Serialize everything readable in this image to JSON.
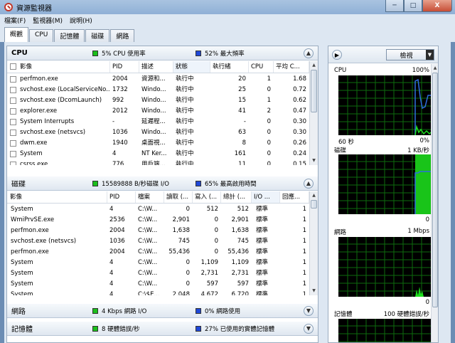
{
  "window": {
    "title": "資源監視器",
    "minimize": "─",
    "maximize": "□",
    "close": "X"
  },
  "menu": [
    "檔案(F)",
    "監視器(M)",
    "說明(H)"
  ],
  "tabs": [
    "概觀",
    "CPU",
    "記憶體",
    "磁碟",
    "網路"
  ],
  "cpu": {
    "title": "CPU",
    "stat1": "5% CPU 使用率",
    "stat1_color": "#1bbf1b",
    "stat2": "52% 最大頻率",
    "stat2_color": "#1f48d8",
    "columns": [
      "影像",
      "PID",
      "描述",
      "狀態",
      "執行緒",
      "CPU",
      "平均 C..."
    ],
    "rows": [
      [
        "perfmon.exe",
        "2004",
        "資源和...",
        "執行中",
        "20",
        "1",
        "1.68"
      ],
      [
        "svchost.exe (LocalServiceNo...",
        "1732",
        "Windo...",
        "執行中",
        "25",
        "0",
        "0.72"
      ],
      [
        "svchost.exe (DcomLaunch)",
        "992",
        "Windo...",
        "執行中",
        "15",
        "1",
        "0.62"
      ],
      [
        "explorer.exe",
        "2012",
        "Windo...",
        "執行中",
        "41",
        "2",
        "0.47"
      ],
      [
        "System Interrupts",
        "-",
        "延遲程...",
        "執行中",
        "-",
        "0",
        "0.30"
      ],
      [
        "svchost.exe (netsvcs)",
        "1036",
        "Windo...",
        "執行中",
        "63",
        "0",
        "0.30"
      ],
      [
        "dwm.exe",
        "1940",
        "桌面視...",
        "執行中",
        "8",
        "0",
        "0.26"
      ],
      [
        "System",
        "4",
        "NT Ker...",
        "執行中",
        "161",
        "0",
        "0.24"
      ],
      [
        "csrss.exe",
        "776",
        "用戶端...",
        "執行中",
        "11",
        "0",
        "0.15"
      ]
    ]
  },
  "disk": {
    "title": "磁碟",
    "stat1": "15589888 B/秒磁碟 I/O",
    "stat1_color": "#1bbf1b",
    "stat2": "65% 最高啟用時間",
    "stat2_color": "#1f48d8",
    "columns": [
      "影像",
      "PID",
      "檔案",
      "讀取 (...",
      "寫入 (...",
      "總計 (...",
      "I/O ...",
      "回應..."
    ],
    "rows": [
      [
        "System",
        "4",
        "C:\\W...",
        "0",
        "512",
        "512",
        "標準",
        "1"
      ],
      [
        "WmiPrvSE.exe",
        "2536",
        "C:\\W...",
        "2,901",
        "0",
        "2,901",
        "標準",
        "1"
      ],
      [
        "perfmon.exe",
        "2004",
        "C:\\W...",
        "1,638",
        "0",
        "1,638",
        "標準",
        "1"
      ],
      [
        "svchost.exe (netsvcs)",
        "1036",
        "C:\\W...",
        "745",
        "0",
        "745",
        "標準",
        "1"
      ],
      [
        "perfmon.exe",
        "2004",
        "C:\\W...",
        "55,436",
        "0",
        "55,436",
        "標準",
        "1"
      ],
      [
        "System",
        "4",
        "C:\\W...",
        "0",
        "1,109",
        "1,109",
        "標準",
        "1"
      ],
      [
        "System",
        "4",
        "C:\\W...",
        "0",
        "2,731",
        "2,731",
        "標準",
        "1"
      ],
      [
        "System",
        "4",
        "C:\\W...",
        "0",
        "597",
        "597",
        "標準",
        "1"
      ],
      [
        "System",
        "4",
        "C:\\$E...",
        "2,048",
        "4,672",
        "6,720",
        "標準",
        "1"
      ]
    ]
  },
  "network": {
    "title": "網路",
    "stat1": "4 Kbps 網路 I/O",
    "stat1_color": "#1bbf1b",
    "stat2": "0% 網路使用",
    "stat2_color": "#1f48d8"
  },
  "memory": {
    "title": "記憶體",
    "stat1": "8 硬體錯誤/秒",
    "stat1_color": "#1bbf1b",
    "stat2": "27% 已使用的實體記憶體",
    "stat2_color": "#1f48d8"
  },
  "right": {
    "view_label": "檢視",
    "graphs": [
      {
        "name": "CPU",
        "max": "100%",
        "caption": "60 秒",
        "min": "0%"
      },
      {
        "name": "磁碟",
        "max": "1 KB/秒",
        "caption": "",
        "min": "0"
      },
      {
        "name": "網路",
        "max": "1 Mbps",
        "caption": "",
        "min": "0"
      },
      {
        "name": "記憶體",
        "max": "100 硬體錯誤/秒",
        "caption": "",
        "min": ""
      }
    ]
  }
}
